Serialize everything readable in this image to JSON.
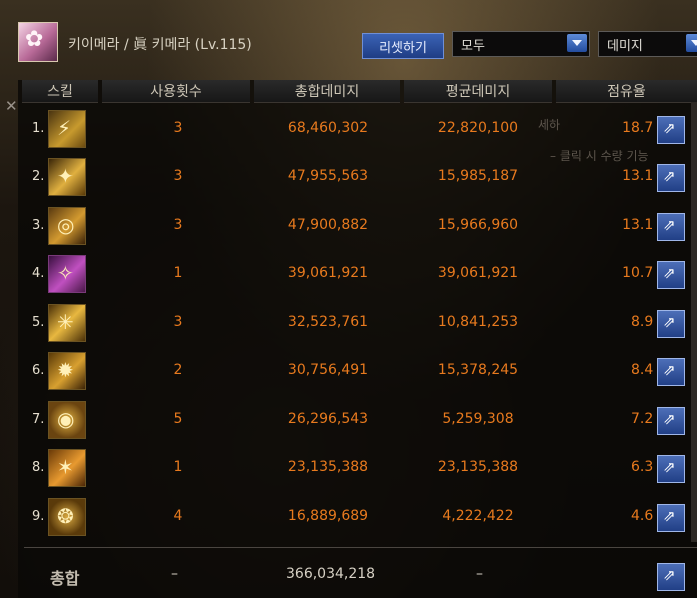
{
  "header": {
    "name": "키이메라 / 眞 키메라 (Lv.115)",
    "reset_label": "리셋하기",
    "filter_value": "모두",
    "metric_value": "데미지"
  },
  "columns": [
    "스킬",
    "사용횟수",
    "총합데미지",
    "평균데미지",
    "점유율"
  ],
  "rows": [
    {
      "index": "1.",
      "uses": "3",
      "total": "68,460,302",
      "avg": "22,820,100",
      "share": "18.7 %"
    },
    {
      "index": "2.",
      "uses": "3",
      "total": "47,955,563",
      "avg": "15,985,187",
      "share": "13.1 %"
    },
    {
      "index": "3.",
      "uses": "3",
      "total": "47,900,882",
      "avg": "15,966,960",
      "share": "13.1 %"
    },
    {
      "index": "4.",
      "uses": "1",
      "total": "39,061,921",
      "avg": "39,061,921",
      "share": "10.7 %"
    },
    {
      "index": "5.",
      "uses": "3",
      "total": "32,523,761",
      "avg": "10,841,253",
      "share": "8.9 %"
    },
    {
      "index": "6.",
      "uses": "2",
      "total": "30,756,491",
      "avg": "15,378,245",
      "share": "8.4 %"
    },
    {
      "index": "7.",
      "uses": "5",
      "total": "26,296,543",
      "avg": "5,259,308",
      "share": "7.2 %"
    },
    {
      "index": "8.",
      "uses": "1",
      "total": "23,135,388",
      "avg": "23,135,388",
      "share": "6.3 %"
    },
    {
      "index": "9.",
      "uses": "4",
      "total": "16,889,689",
      "avg": "4,222,422",
      "share": "4.6 %"
    }
  ],
  "totals": {
    "label": "총합",
    "uses": "–",
    "total": "366,034,218",
    "avg": "–"
  },
  "background_hints": [
    "세하",
    "– 클릭 시 수량 기능"
  ],
  "colors": {
    "value": "#e87a1e",
    "header_text": "#cdc6b6",
    "button": "#2f55a8"
  },
  "icons": [
    "share-icon",
    "dropdown-arrow-icon",
    "close-icon"
  ]
}
